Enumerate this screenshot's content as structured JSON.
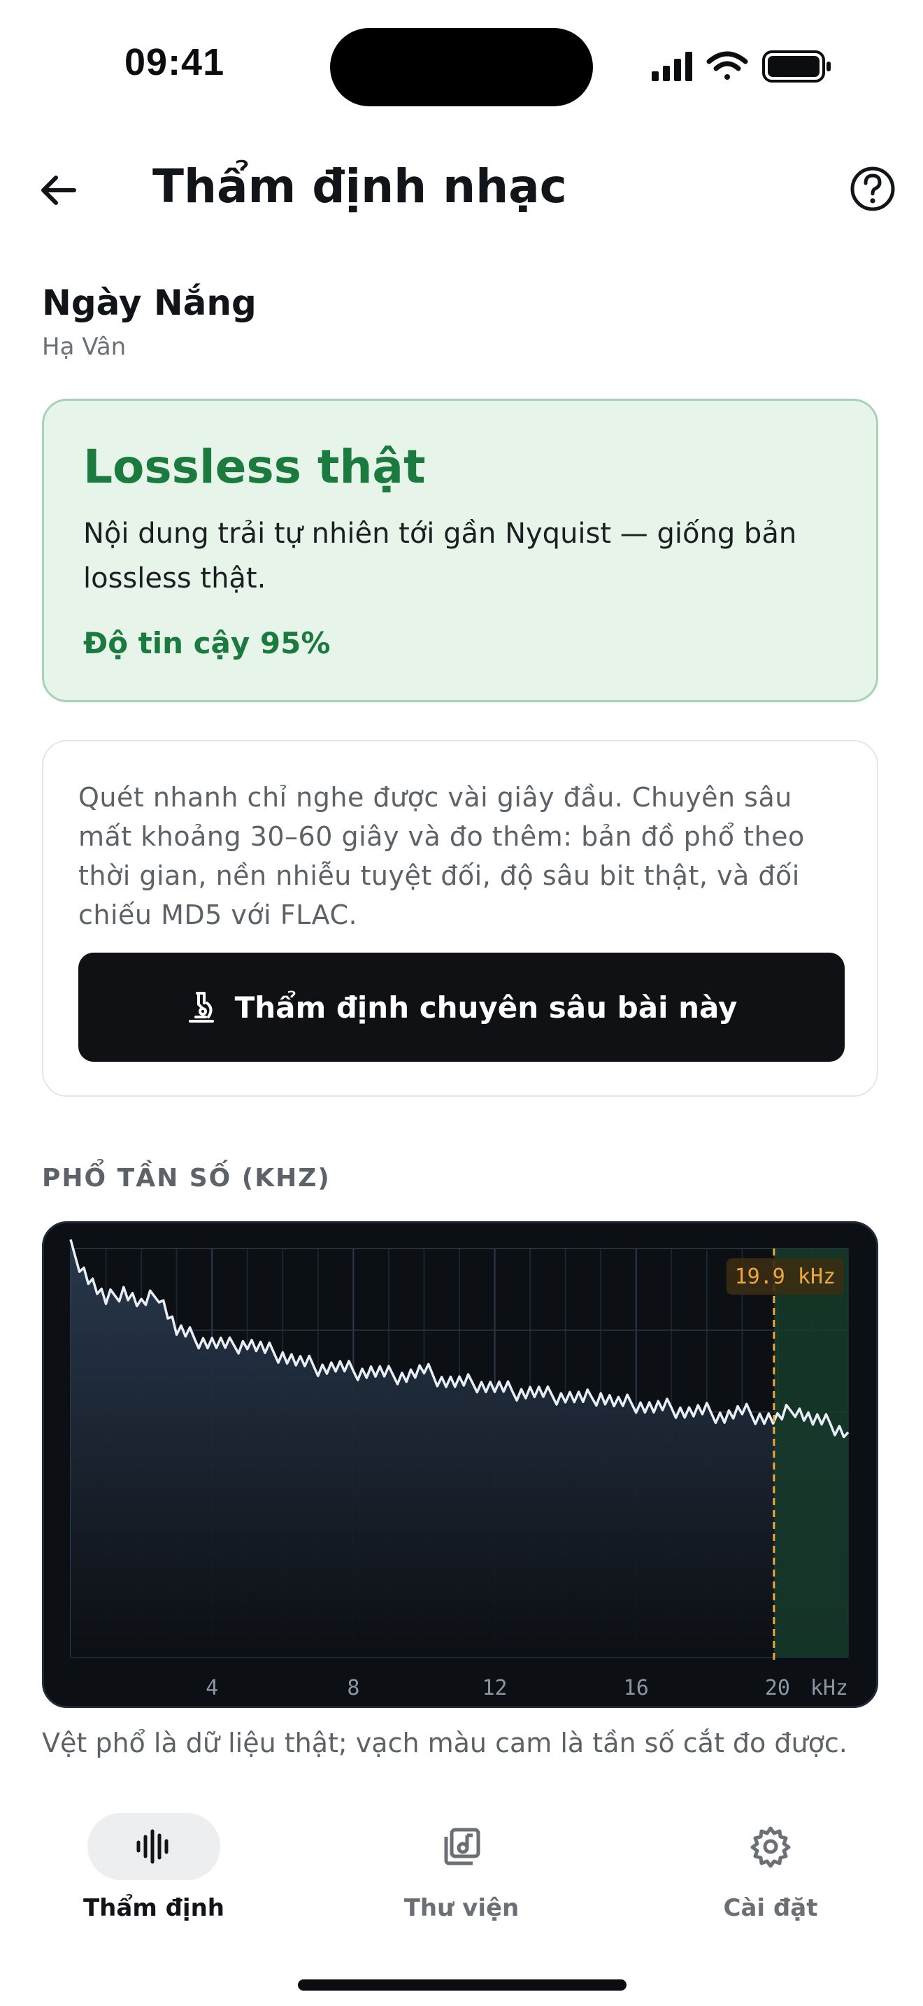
{
  "status": {
    "time": "09:41"
  },
  "header": {
    "title": "Thẩm định nhạc"
  },
  "song": {
    "title": "Ngày Nắng",
    "artist": "Hạ Vân"
  },
  "verdict": {
    "title": "Lossless thật",
    "description": "Nội dung trải tự nhiên tới gần Nyquist — giống bản lossless thật.",
    "confidence": "Độ tin cậy 95%",
    "accent_color": "#1b7a3d",
    "background_color": "#e6f4ea"
  },
  "deep": {
    "description": "Quét nhanh chỉ nghe được vài giây đầu. Chuyên sâu mất khoảng 30–60 giây và đo thêm: bản đồ phổ theo thời gian, nền nhiễu tuyệt đối, độ sâu bit thật, và đối chiếu MD5 với FLAC.",
    "button_label": "Thẩm định chuyên sâu bài này"
  },
  "spectrum": {
    "section_label": "PHỔ TẦN SỐ (KHZ)",
    "note": "Vệt phổ là dữ liệu thật; vạch màu cam là tần số cắt đo được."
  },
  "chart_data": {
    "type": "area",
    "x_ticks": [
      "4",
      "8",
      "12",
      "16",
      "20"
    ],
    "x_unit": "kHz",
    "xlim": [
      0,
      22
    ],
    "cutoff_khz": 19.9,
    "cutoff_label": "19.9 kHz",
    "cutoff_color": "#f0a73a",
    "line_color": "#e8eef5",
    "fill_color": "#2a3a50",
    "cutoff_region_color": "#163b2a",
    "grid": true,
    "ylim": [
      0,
      1
    ],
    "x": [
      0,
      0.5,
      1,
      1.5,
      2,
      2.5,
      3,
      3.5,
      4,
      4.5,
      5,
      5.5,
      6,
      6.5,
      7,
      7.5,
      8,
      8.5,
      9,
      9.5,
      10,
      10.5,
      11,
      11.5,
      12,
      12.5,
      13,
      13.5,
      14,
      14.5,
      15,
      15.5,
      16,
      16.5,
      17,
      17.5,
      18,
      18.5,
      19,
      19.5,
      20,
      20.5,
      21,
      21.5,
      22
    ],
    "y": [
      1.0,
      0.93,
      0.87,
      0.9,
      0.86,
      0.89,
      0.8,
      0.78,
      0.77,
      0.76,
      0.77,
      0.75,
      0.74,
      0.72,
      0.71,
      0.71,
      0.7,
      0.7,
      0.69,
      0.69,
      0.7,
      0.68,
      0.67,
      0.67,
      0.66,
      0.65,
      0.65,
      0.64,
      0.64,
      0.63,
      0.64,
      0.62,
      0.62,
      0.61,
      0.61,
      0.6,
      0.6,
      0.59,
      0.6,
      0.59,
      0.58,
      0.61,
      0.58,
      0.57,
      0.55
    ]
  },
  "tabs": [
    {
      "label": "Thẩm định",
      "icon": "waveform-icon",
      "active": true
    },
    {
      "label": "Thư viện",
      "icon": "music-library-icon",
      "active": false
    },
    {
      "label": "Cài đặt",
      "icon": "gear-icon",
      "active": false
    }
  ]
}
